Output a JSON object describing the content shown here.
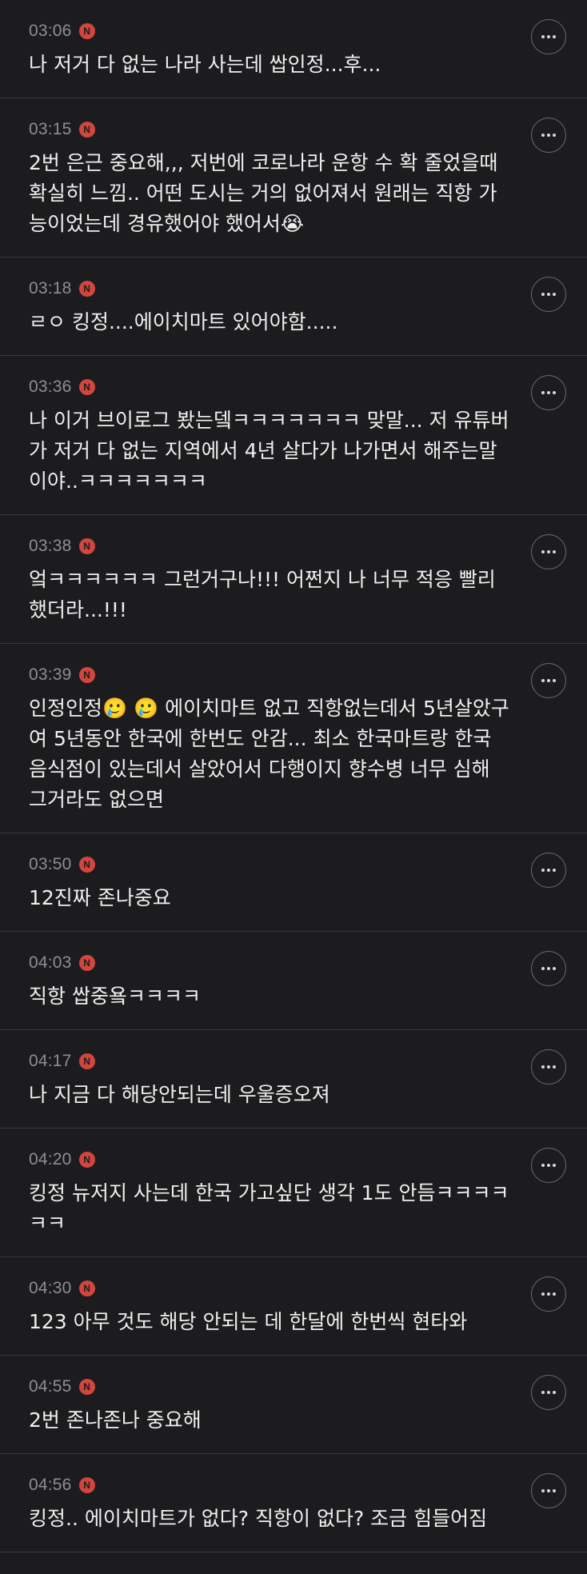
{
  "comments": [
    {
      "time": "03:06",
      "badge": "N",
      "text": "나 저거 다 없는 나라 사는데 쌉인정...후..."
    },
    {
      "time": "03:15",
      "badge": "N",
      "text": "2번 은근 중요해,,, 저번에 코로나라 운항 수 확 줄었을때 확실히 느낌.. 어떤 도시는 거의 없어져서 원래는 직항 가능이었는데 경유했어야 했어서😭"
    },
    {
      "time": "03:18",
      "badge": "N",
      "text": "ㄹㅇ 킹정....에이치마트 있어야함....."
    },
    {
      "time": "03:36",
      "badge": "N",
      "text": "나 이거 브이로그 봤는뎈ㅋㅋㅋㅋㅋㅋㅋ 맞말... 저 유튜버가 저거 다 없는 지역에서 4년 살다가 나가면서 해주는말이야..ㅋㅋㅋㅋㅋㅋㅋ"
    },
    {
      "time": "03:38",
      "badge": "N",
      "text": "엌ㅋㅋㅋㅋㅋㅋ 그런거구나!!! 어쩐지 나 너무 적응 빨리 했더라...!!!"
    },
    {
      "time": "03:39",
      "badge": "N",
      "text": "인정인정🥲 🥲 에이치마트 없고 직항없는데서 5년살았구여 5년동안 한국에 한번도 안감... 최소 한국마트랑 한국 음식점이 있는데서 살았어서 다행이지 향수병 너무 심해 그거라도 없으면"
    },
    {
      "time": "03:50",
      "badge": "N",
      "text": "12진짜 존나중요"
    },
    {
      "time": "04:03",
      "badge": "N",
      "text": "직항 쌉중욬ㅋㅋㅋㅋ"
    },
    {
      "time": "04:17",
      "badge": "N",
      "text": "나 지금 다 해당안되는데 우울증오져"
    },
    {
      "time": "04:20",
      "badge": "N",
      "text": "킹정 뉴저지 사는데 한국 가고싶단 생각 1도 안듬ㅋㅋㅋㅋㅋㅋ"
    },
    {
      "time": "04:30",
      "badge": "N",
      "text": "123 아무 것도 해당 안되는 데 한달에 한번씩 현타와"
    },
    {
      "time": "04:55",
      "badge": "N",
      "text": "2번 존나존나 중요해"
    },
    {
      "time": "04:56",
      "badge": "N",
      "text": "킹정.. 에이치마트가 없다? 직항이 없다? 조금 힘들어짐"
    }
  ],
  "icons": {
    "more": "more-horizontal-icon",
    "badge": "new-badge-icon"
  },
  "colors": {
    "background": "#1c1c1e",
    "text": "#efefef",
    "time": "#8e8e93",
    "badge": "#d1463f",
    "divider": "#3a3a3c"
  }
}
